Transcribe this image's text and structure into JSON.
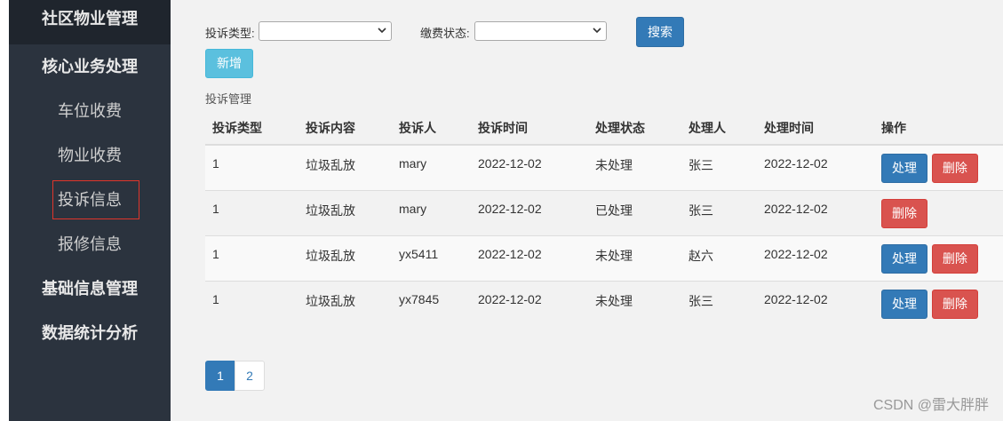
{
  "sidebar": {
    "title": "社区物业管理",
    "groups": [
      {
        "label": "核心业务处理"
      },
      {
        "label": "基础信息管理"
      },
      {
        "label": "数据统计分析"
      }
    ],
    "items": [
      {
        "label": "车位收费"
      },
      {
        "label": "物业收费"
      },
      {
        "label": "投诉信息",
        "active": true
      },
      {
        "label": "报修信息"
      }
    ]
  },
  "filters": {
    "type_label": "投诉类型:",
    "type_value": "",
    "status_label": "缴费状态:",
    "status_value": "",
    "search_label": "搜索"
  },
  "add_label": "新增",
  "section_title": "投诉管理",
  "table": {
    "headers": [
      "投诉类型",
      "投诉内容",
      "投诉人",
      "投诉时间",
      "处理状态",
      "处理人",
      "处理时间",
      "操作"
    ],
    "rows": [
      {
        "type": "1",
        "content": "垃圾乱放",
        "complainant": "mary",
        "time": "2022-12-02",
        "status": "未处理",
        "handler": "张三",
        "handle_time": "2022-12-02",
        "actions": [
          "处理",
          "删除"
        ]
      },
      {
        "type": "1",
        "content": "垃圾乱放",
        "complainant": "mary",
        "time": "2022-12-02",
        "status": "已处理",
        "handler": "张三",
        "handle_time": "2022-12-02",
        "actions": [
          "删除"
        ]
      },
      {
        "type": "1",
        "content": "垃圾乱放",
        "complainant": "yx5411",
        "time": "2022-12-02",
        "status": "未处理",
        "handler": "赵六",
        "handle_time": "2022-12-02",
        "actions": [
          "处理",
          "删除"
        ]
      },
      {
        "type": "1",
        "content": "垃圾乱放",
        "complainant": "yx7845",
        "time": "2022-12-02",
        "status": "未处理",
        "handler": "张三",
        "handle_time": "2022-12-02",
        "actions": [
          "处理",
          "删除"
        ]
      }
    ]
  },
  "pagination": {
    "pages": [
      "1",
      "2"
    ],
    "current": "1"
  },
  "watermark": "CSDN @雷大胖胖",
  "colors": {
    "sidebar_bg": "#2b333e",
    "primary": "#337ab7",
    "info": "#5bc0de",
    "danger": "#d9534f"
  }
}
